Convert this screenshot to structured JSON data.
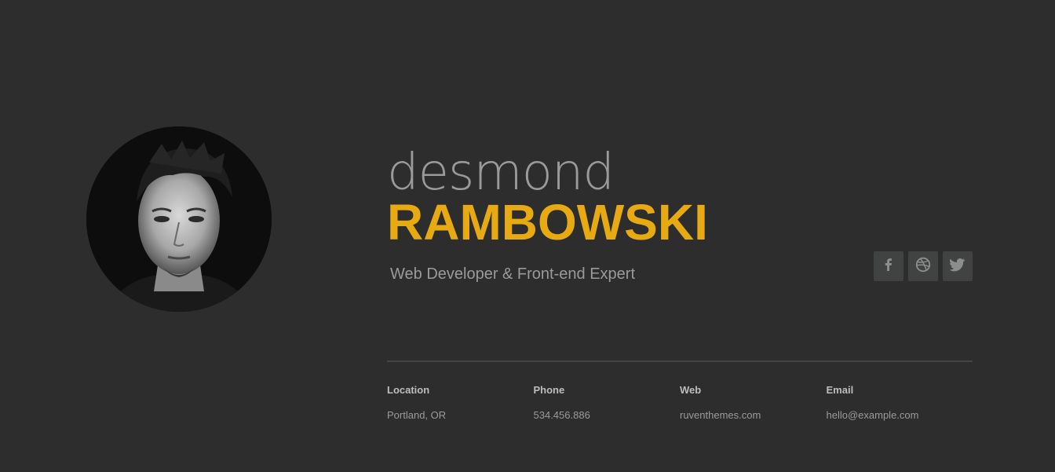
{
  "profile": {
    "first_name": "desmond",
    "last_name": "RAMBOWSKI",
    "subtitle": "Web Developer & Front-end Expert"
  },
  "social": [
    {
      "icon": "facebook-icon",
      "label": "f"
    },
    {
      "icon": "dribbble-icon",
      "label": "dribbble"
    },
    {
      "icon": "twitter-icon",
      "label": "twitter"
    }
  ],
  "info": [
    {
      "label": "Location",
      "value": "Portland, OR"
    },
    {
      "label": "Phone",
      "value": "534.456.886"
    },
    {
      "label": "Web",
      "value": "ruventhemes.com"
    },
    {
      "label": "Email",
      "value": "hello@example.com"
    }
  ],
  "colors": {
    "background": "#2c2d2c",
    "accent": "#e8aa12",
    "muted_text": "#9a9a9a",
    "social_bg": "#414242"
  }
}
